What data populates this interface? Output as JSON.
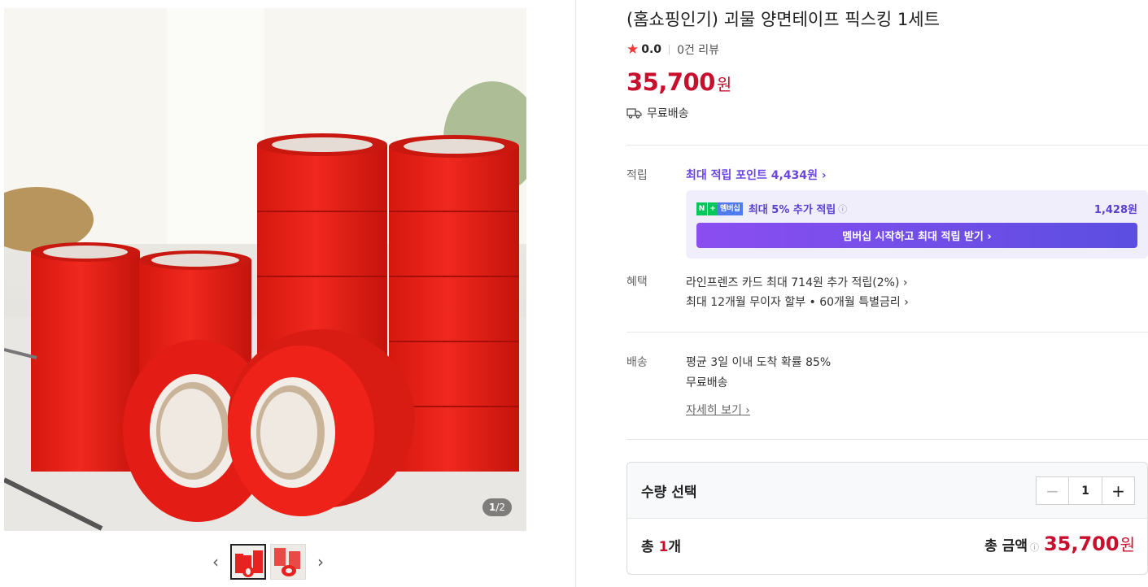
{
  "gallery": {
    "counter_current": "1",
    "counter_total": "/2",
    "prev_label": "‹",
    "next_label": "›"
  },
  "product": {
    "title": "(홈쇼핑인기) 괴물 양면테이프 픽스킹 1세트",
    "rating": "0.0",
    "review_count": "0건 리뷰",
    "price": "35,700",
    "price_unit": "원",
    "shipping": "무료배송"
  },
  "points": {
    "label": "적립",
    "max_text": "최대 적립 포인트 4,434원",
    "membership_badge_n": "N",
    "membership_badge_plus": "+",
    "membership_badge_text": "멤버십",
    "membership_text": "최대 5% 추가 적립",
    "membership_amount": "1,428원",
    "membership_button": "멤버십 시작하고 최대 적립 받기 ›"
  },
  "benefits": {
    "label": "혜택",
    "line1": "라인프렌즈 카드 최대 714원 추가 적립(2%) ›",
    "line2": "최대 12개월 무이자 할부 • 60개월 특별금리 ›"
  },
  "delivery": {
    "label": "배송",
    "line1": "평균 3일 이내 도착 확률 85%",
    "line2": "무료배송",
    "detail": "자세히 보기"
  },
  "quantity": {
    "title": "수량 선택",
    "minus": "−",
    "value": "1",
    "plus": "+",
    "total_prefix": "총 ",
    "total_count": "1",
    "total_suffix": "개",
    "sum_label": "총 금액",
    "sum_value": "35,700",
    "sum_unit": "원"
  },
  "colors": {
    "price_red": "#c8102e",
    "point_purple": "#6b46e0",
    "tape_red": "#e8221e"
  }
}
